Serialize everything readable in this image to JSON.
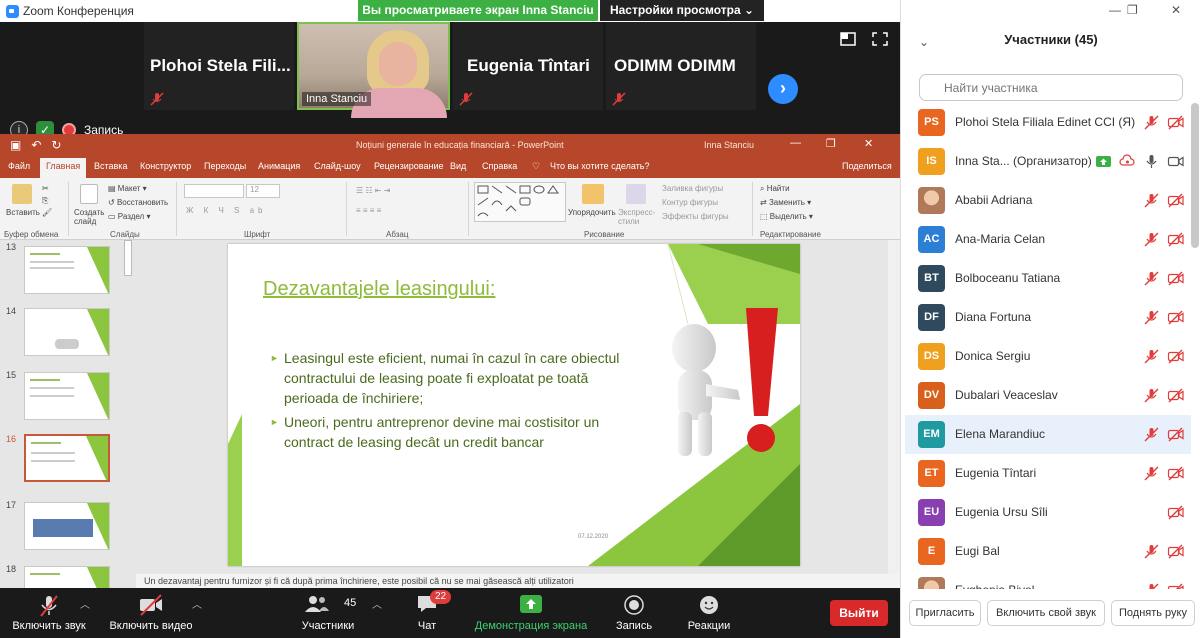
{
  "window": {
    "title": "Zoom Конференция"
  },
  "banner": {
    "sharing_text": "Вы просматриваете экран Inna Stanciu",
    "view_settings": "Настройки просмотра"
  },
  "video_strip": {
    "tiles": [
      {
        "name": "Plohoi  Stela  Fili..."
      },
      {
        "name": "Inna Stanciu"
      },
      {
        "name": "Eugenia Tîntari"
      },
      {
        "name": "ODIMM ODIMM"
      }
    ]
  },
  "meeting": {
    "info_icon": "i",
    "recording_label": "Запись"
  },
  "powerpoint": {
    "doc_title": "Noțiuni generale în educația financiară  -  PowerPoint",
    "user": "Inna Stanciu",
    "tabs": [
      "Файл",
      "Главная",
      "Вставка",
      "Конструктор",
      "Переходы",
      "Анимация",
      "Слайд-шоу",
      "Рецензирование",
      "Вид",
      "Справка",
      "Что вы хотите сделать?",
      "Поделиться"
    ],
    "ribbon": {
      "paste": "Вставить",
      "new_slide": "Создать слайд",
      "layout": "Макет",
      "restore": "Восстановить",
      "section": "Раздел",
      "font_size": "12",
      "arrange": "Упорядочить",
      "quick_styles": "Экспресс-стили",
      "shape_fill": "Заливка фигуры",
      "shape_outline": "Контур фигуры",
      "shape_effects": "Эффекты фигуры",
      "find": "Найти",
      "replace": "Заменить",
      "select": "Выделить",
      "groups": [
        "Буфер обмена",
        "Слайды",
        "Шрифт",
        "Абзац",
        "Рисование",
        "Редактирование"
      ]
    },
    "thumb_numbers": [
      "13",
      "14",
      "15",
      "16",
      "17",
      "18"
    ],
    "slide": {
      "title": "Dezavantajele leasingului:",
      "bullets": [
        "Leasingul este eficient, numai în cazul în care obiectul contractului de leasing poate fi exploatat pe toată perioada de închiriere;",
        "Uneori, pentru antreprenor devine mai costisitor un contract de leasing decât un credit bancar"
      ],
      "date": "07.12.2020"
    },
    "notes": "Un dezavantaj pentru furnizor și fi că după prima închiriere, este posibil că nu se mai găsească alți utilizatori"
  },
  "toolbar": {
    "unmute": "Включить звук",
    "start_video": "Включить видео",
    "participants": "Участники",
    "participants_count": "45",
    "chat": "Чат",
    "chat_badge": "22",
    "share_screen": "Демонстрация экрана",
    "record": "Запись",
    "reactions": "Реакции",
    "end": "Выйти"
  },
  "panel": {
    "title": "Участники (45)",
    "search_placeholder": "Найти участника",
    "participants": [
      {
        "initials": "PS",
        "name": "Plohoi Stela Filiala Edinet CCI (Я)",
        "color": "#e8661f"
      },
      {
        "initials": "IS",
        "name": "Inna Sta... (Организатор)",
        "color": "#f0a01f"
      },
      {
        "initials": "",
        "name": "Ababii Adriana",
        "color": "#b07a5a"
      },
      {
        "initials": "AC",
        "name": "Ana-Maria Celan",
        "color": "#2d7fd6"
      },
      {
        "initials": "BT",
        "name": "Bolboceanu Tatiana",
        "color": "#2f4a5e"
      },
      {
        "initials": "DF",
        "name": "Diana Fortuna",
        "color": "#2f4a5e"
      },
      {
        "initials": "DS",
        "name": "Donica Sergiu",
        "color": "#f0a01f"
      },
      {
        "initials": "DV",
        "name": "Dubalari Veaceslav",
        "color": "#d9601a"
      },
      {
        "initials": "EM",
        "name": "Elena Marandiuc",
        "color": "#1f9aa0"
      },
      {
        "initials": "ET",
        "name": "Eugenia Tîntari",
        "color": "#e8661f"
      },
      {
        "initials": "EU",
        "name": "Eugenia Ursu Sîli",
        "color": "#8a3fb0"
      },
      {
        "initials": "E",
        "name": "Eugi Bal",
        "color": "#e8661f"
      },
      {
        "initials": "",
        "name": "Evghenia Bivol",
        "color": "#b07a5a"
      }
    ],
    "buttons": {
      "invite": "Пригласить",
      "unmute_me": "Включить свой звук",
      "raise_hand": "Поднять руку"
    }
  }
}
